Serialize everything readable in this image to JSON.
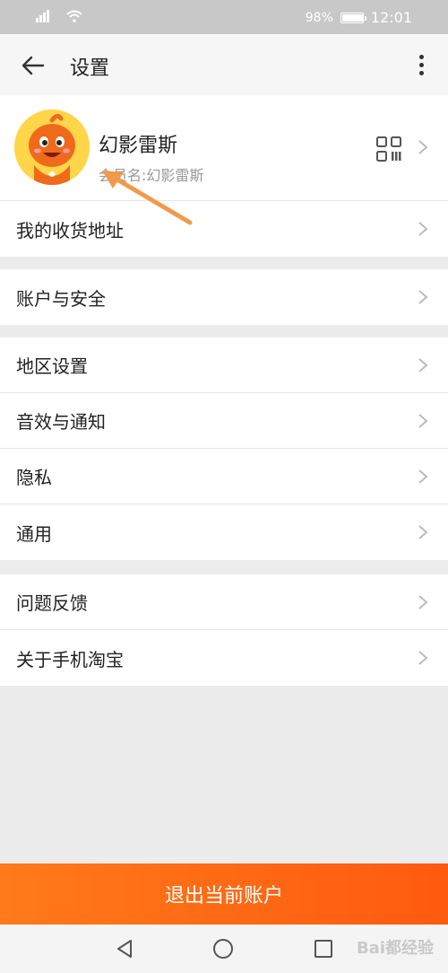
{
  "status_bar": {
    "signal": "₂₃Ͱ",
    "battery": "98%",
    "battery_level": 0.98,
    "time": "12:01"
  },
  "header": {
    "title": "设置",
    "back_icon": "arrow-left-icon",
    "more_icon": "more-vertical-icon"
  },
  "profile": {
    "name": "幻影雷斯",
    "member_label": "会员名:幻影雷斯",
    "qr_icon": "qr-code-icon"
  },
  "sections": [
    {
      "items": [
        "我的收货地址"
      ]
    },
    {
      "items": [
        "账户与安全"
      ]
    },
    {
      "items": [
        "地区设置",
        "音效与通知",
        "隐私",
        "通用"
      ]
    },
    {
      "items": [
        "问题反馈",
        "关于手机淘宝"
      ]
    }
  ],
  "logout_label": "退出当前账户",
  "watermark": "Bai都经验",
  "colors": {
    "accent": "#ff6a14",
    "annotation_arrow": "#f2994a",
    "avatar_bg": "#ffd54a"
  }
}
